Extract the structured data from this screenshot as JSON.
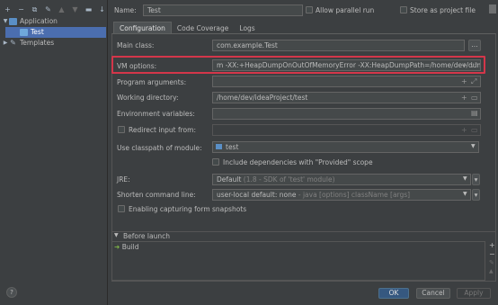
{
  "toolbar": {
    "icons": [
      "add-icon",
      "remove-icon",
      "copy-icon",
      "wrench-icon",
      "move-up-icon",
      "move-down-icon",
      "folder-icon",
      "sort-icon"
    ]
  },
  "tree": {
    "application_label": "Application",
    "test_label": "Test",
    "templates_label": "Templates"
  },
  "header": {
    "name_label": "Name:",
    "name_value": "Test",
    "allow_parallel_label": "Allow parallel run",
    "store_project_label": "Store as project file"
  },
  "tabs": [
    {
      "label": "Configuration"
    },
    {
      "label": "Code Coverage"
    },
    {
      "label": "Logs"
    }
  ],
  "form": {
    "main_class_label": "Main class:",
    "main_class_value": "com.example.Test",
    "browse_label": "...",
    "vm_options_label": "VM options:",
    "vm_options_value": "m -XX:+HeapDumpOnOutOfMemoryError -XX:HeapDumpPath=/home/dev/dump",
    "program_args_label": "Program arguments:",
    "program_args_value": "",
    "working_dir_label": "Working directory:",
    "working_dir_value": "/home/dev/ideaProject/test",
    "env_vars_label": "Environment variables:",
    "env_vars_value": "",
    "redirect_label": "Redirect input from:",
    "classpath_label": "Use classpath of module:",
    "classpath_value": "test",
    "include_deps_label": "Include dependencies with \"Provided\" scope",
    "jre_label": "JRE:",
    "jre_value": "Default",
    "jre_hint": "(1.8 - SDK of 'test' module)",
    "shorten_label": "Shorten command line:",
    "shorten_value": "user-local default: none",
    "shorten_hint": "- java [options] className [args]",
    "capture_label": "Enabling capturing form snapshots"
  },
  "before_launch": {
    "title": "Before launch",
    "items": [
      "Build"
    ]
  },
  "footer": {
    "help_label": "?",
    "ok_label": "OK",
    "cancel_label": "Cancel",
    "apply_label": "Apply"
  },
  "colors": {
    "highlight_border": "#d4364a",
    "selection": "#4b6eaf",
    "primary_button": "#365880"
  }
}
